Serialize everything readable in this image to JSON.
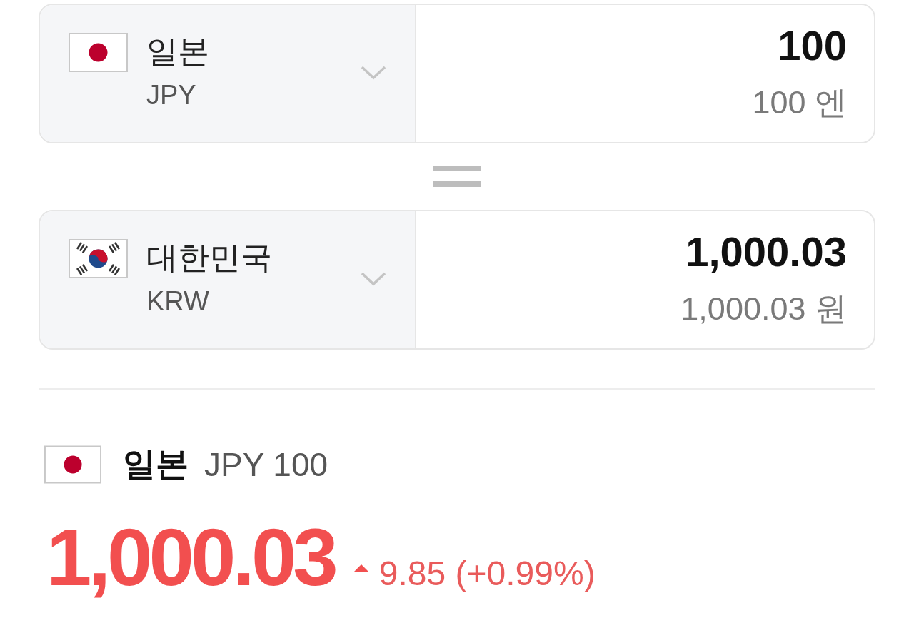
{
  "converter": [
    {
      "kind": "jp",
      "country": "일본",
      "code": "JPY",
      "amount": "100",
      "amount_text": "100 엔"
    },
    {
      "kind": "kr",
      "country": "대한민국",
      "code": "KRW",
      "amount": "1,000.03",
      "amount_text": "1,000.03 원"
    }
  ],
  "rate": {
    "currency": {
      "kind": "jp",
      "country": "일본",
      "unit": "JPY 100"
    },
    "value": "1,000.03",
    "rising": true,
    "change": "9.85 (+0.99%)"
  }
}
